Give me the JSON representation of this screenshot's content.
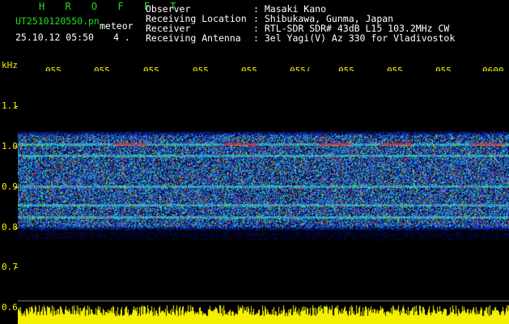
{
  "header": {
    "brand": "H R O F F T",
    "filename": "UT2510120550.pn",
    "mode": "meteor",
    "datetime": "25.10.12 05:50",
    "count": "4 ."
  },
  "info": {
    "observer_label": "Observer",
    "observer_value": ": Masaki Kano",
    "location_label": "Receiving Location",
    "location_value": ": Shibukawa, Gunma, Japan",
    "receiver_label": "Receiver",
    "receiver_value": ": RTL-SDR SDR# 43dB L15 103.2MHz CW",
    "antenna_label": "Receiving Antenna",
    "antenna_value": ": 3el Yagi(V) Az 330 for Vladivostok"
  },
  "axis": {
    "unit": "kHz",
    "x_ticks": [
      "055",
      "055",
      "055",
      "055",
      "055",
      "055(",
      "055",
      "055",
      "055",
      "0600"
    ],
    "y_ticks": [
      "1.1",
      "1.0",
      "0.9",
      "0.8",
      "0.7",
      "0.6"
    ]
  },
  "colors": {
    "label_yellow": "#f5f000",
    "brand_green": "#22dd22",
    "signal_band_blue": "#1040e0",
    "meteor_red": "#ff2020"
  }
}
